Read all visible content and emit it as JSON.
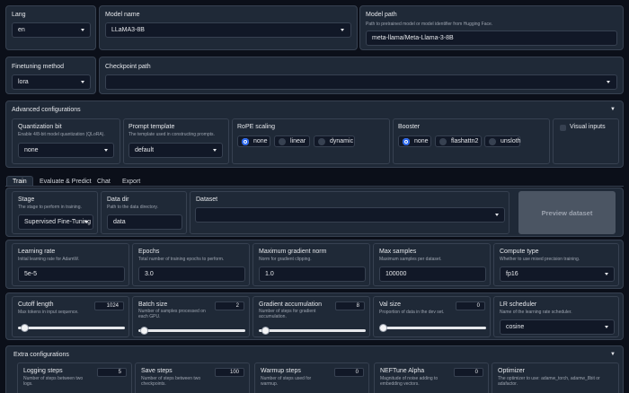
{
  "top": {
    "lang": {
      "label": "Lang",
      "value": "en"
    },
    "model_name": {
      "label": "Model name",
      "value": "LLaMA3-8B"
    },
    "model_path": {
      "label": "Model path",
      "hint": "Path to pretrained model or model identifier from Hugging Face.",
      "value": "meta-llama/Meta-Llama-3-8B"
    }
  },
  "row2": {
    "finetuning": {
      "label": "Finetuning method",
      "value": "lora"
    },
    "checkpoint": {
      "label": "Checkpoint path",
      "value": ""
    }
  },
  "advanced": {
    "title": "Advanced configurations",
    "quant": {
      "label": "Quantization bit",
      "hint": "Enable 4/8-bit model quantization (QLoRA).",
      "value": "none"
    },
    "prompt": {
      "label": "Prompt template",
      "hint": "The template used in constructing prompts.",
      "value": "default"
    },
    "rope": {
      "label": "RoPE scaling",
      "options": [
        "none",
        "linear",
        "dynamic"
      ],
      "selected": "none"
    },
    "booster": {
      "label": "Booster",
      "options": [
        "none",
        "flashattn2",
        "unsloth"
      ],
      "selected": "none"
    },
    "visual": {
      "label": "Visual inputs"
    }
  },
  "tabs": [
    "Train",
    "Evaluate & Predict",
    "Chat",
    "Export"
  ],
  "train": {
    "stage": {
      "label": "Stage",
      "hint": "The stage to perform in training.",
      "value": "Supervised Fine-Tuning"
    },
    "data_dir": {
      "label": "Data dir",
      "hint": "Path to the data directory.",
      "value": "data"
    },
    "dataset": {
      "label": "Dataset",
      "value": ""
    },
    "preview_button": "Preview dataset",
    "learning_rate": {
      "label": "Learning rate",
      "hint": "Initial learning rate for AdamW.",
      "value": "5e-5"
    },
    "epochs": {
      "label": "Epochs",
      "hint": "Total number of training epochs to perform.",
      "value": "3.0"
    },
    "max_grad": {
      "label": "Maximum gradient norm",
      "hint": "Norm for gradient clipping.",
      "value": "1.0"
    },
    "max_samples": {
      "label": "Max samples",
      "hint": "Maximum samples per dataset.",
      "value": "100000"
    },
    "compute_type": {
      "label": "Compute type",
      "hint": "Whether to use mixed precision training.",
      "value": "fp16"
    },
    "cutoff": {
      "label": "Cutoff length",
      "hint": "Max tokens in input sequence.",
      "value": "1024",
      "fraction": 0.03
    },
    "batch": {
      "label": "Batch size",
      "hint": "Number of samples processed on each GPU.",
      "value": "2",
      "fraction": 0.02
    },
    "grad_acc": {
      "label": "Gradient accumulation",
      "hint": "Number of steps for gradient accumulation.",
      "value": "8",
      "fraction": 0.03
    },
    "val_size": {
      "label": "Val size",
      "hint": "Proportion of data in the dev set.",
      "value": "0",
      "fraction": 0
    },
    "scheduler": {
      "label": "LR scheduler",
      "hint": "Name of the learning rate scheduler.",
      "value": "cosine"
    }
  },
  "extra": {
    "title": "Extra configurations",
    "logging": {
      "label": "Logging steps",
      "hint": "Number of steps between two logs.",
      "value": "5"
    },
    "save": {
      "label": "Save steps",
      "hint": "Number of steps between two checkpoints.",
      "value": "100"
    },
    "warmup": {
      "label": "Warmup steps",
      "hint": "Number of steps used for warmup.",
      "value": "0"
    },
    "neftune": {
      "label": "NEFTune Alpha",
      "hint": "Magnitude of noise adding to embedding vectors.",
      "value": "0"
    },
    "optimizer": {
      "label": "Optimizer",
      "hint": "The optimizer to use: adamw_torch, adamw_8bit or adafactor."
    }
  },
  "colors": {
    "accent": "#2563eb",
    "panel": "#1f2937",
    "background": "#0b0f19"
  }
}
